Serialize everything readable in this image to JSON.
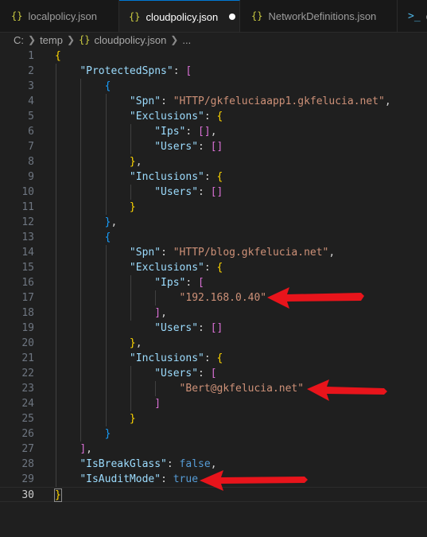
{
  "tabs": [
    {
      "label": "localpolicy.json",
      "active": false
    },
    {
      "label": "cloudpolicy.json",
      "active": true,
      "modified": true
    },
    {
      "label": "NetworkDefinitions.json",
      "active": false
    },
    {
      "label": "c",
      "active": false
    }
  ],
  "breadcrumb": [
    "C:",
    "temp",
    "cloudpolicy.json",
    "..."
  ],
  "colors": {
    "key": "#9cdcfe",
    "string": "#ce9178",
    "keyword": "#569cd6",
    "bracket_level1": "#ffd700",
    "bracket_level2": "#da70d6",
    "bracket_level3": "#179fff",
    "arrow": "#e8141b"
  },
  "annotations": [
    {
      "points_to_line": 17
    },
    {
      "points_to_line": 23
    },
    {
      "points_to_line": 29
    }
  ],
  "lines": [
    [
      [
        "b1",
        "{"
      ]
    ],
    [
      [
        "p",
        "    "
      ],
      [
        "k",
        "\"ProtectedSpns\""
      ],
      [
        "p",
        ": "
      ],
      [
        "b2",
        "["
      ]
    ],
    [
      [
        "p",
        "        "
      ],
      [
        "b3",
        "{"
      ]
    ],
    [
      [
        "p",
        "            "
      ],
      [
        "k",
        "\"Spn\""
      ],
      [
        "p",
        ": "
      ],
      [
        "s",
        "\"HTTP/gkfeluciaapp1.gkfelucia.net\""
      ],
      [
        "p",
        ","
      ]
    ],
    [
      [
        "p",
        "            "
      ],
      [
        "k",
        "\"Exclusions\""
      ],
      [
        "p",
        ": "
      ],
      [
        "b1",
        "{"
      ]
    ],
    [
      [
        "p",
        "                "
      ],
      [
        "k",
        "\"Ips\""
      ],
      [
        "p",
        ": "
      ],
      [
        "b2",
        "[]"
      ],
      [
        "p",
        ","
      ]
    ],
    [
      [
        "p",
        "                "
      ],
      [
        "k",
        "\"Users\""
      ],
      [
        "p",
        ": "
      ],
      [
        "b2",
        "[]"
      ]
    ],
    [
      [
        "p",
        "            "
      ],
      [
        "b1",
        "}"
      ],
      [
        "p",
        ","
      ]
    ],
    [
      [
        "p",
        "            "
      ],
      [
        "k",
        "\"Inclusions\""
      ],
      [
        "p",
        ": "
      ],
      [
        "b1",
        "{"
      ]
    ],
    [
      [
        "p",
        "                "
      ],
      [
        "k",
        "\"Users\""
      ],
      [
        "p",
        ": "
      ],
      [
        "b2",
        "[]"
      ]
    ],
    [
      [
        "p",
        "            "
      ],
      [
        "b1",
        "}"
      ]
    ],
    [
      [
        "p",
        "        "
      ],
      [
        "b3",
        "}"
      ],
      [
        "p",
        ","
      ]
    ],
    [
      [
        "p",
        "        "
      ],
      [
        "b3",
        "{"
      ]
    ],
    [
      [
        "p",
        "            "
      ],
      [
        "k",
        "\"Spn\""
      ],
      [
        "p",
        ": "
      ],
      [
        "s",
        "\"HTTP/blog.gkfelucia.net\""
      ],
      [
        "p",
        ","
      ]
    ],
    [
      [
        "p",
        "            "
      ],
      [
        "k",
        "\"Exclusions\""
      ],
      [
        "p",
        ": "
      ],
      [
        "b1",
        "{"
      ]
    ],
    [
      [
        "p",
        "                "
      ],
      [
        "k",
        "\"Ips\""
      ],
      [
        "p",
        ": "
      ],
      [
        "b2",
        "["
      ]
    ],
    [
      [
        "p",
        "                    "
      ],
      [
        "s",
        "\"192.168.0.40\""
      ]
    ],
    [
      [
        "p",
        "                "
      ],
      [
        "b2",
        "]"
      ],
      [
        "p",
        ","
      ]
    ],
    [
      [
        "p",
        "                "
      ],
      [
        "k",
        "\"Users\""
      ],
      [
        "p",
        ": "
      ],
      [
        "b2",
        "[]"
      ]
    ],
    [
      [
        "p",
        "            "
      ],
      [
        "b1",
        "}"
      ],
      [
        "p",
        ","
      ]
    ],
    [
      [
        "p",
        "            "
      ],
      [
        "k",
        "\"Inclusions\""
      ],
      [
        "p",
        ": "
      ],
      [
        "b1",
        "{"
      ]
    ],
    [
      [
        "p",
        "                "
      ],
      [
        "k",
        "\"Users\""
      ],
      [
        "p",
        ": "
      ],
      [
        "b2",
        "["
      ]
    ],
    [
      [
        "p",
        "                    "
      ],
      [
        "s",
        "\"Bert@gkfelucia.net\""
      ]
    ],
    [
      [
        "p",
        "                "
      ],
      [
        "b2",
        "]"
      ]
    ],
    [
      [
        "p",
        "            "
      ],
      [
        "b1",
        "}"
      ]
    ],
    [
      [
        "p",
        "        "
      ],
      [
        "b3",
        "}"
      ]
    ],
    [
      [
        "p",
        "    "
      ],
      [
        "b2",
        "]"
      ],
      [
        "p",
        ","
      ]
    ],
    [
      [
        "p",
        "    "
      ],
      [
        "k",
        "\"IsBreakGlass\""
      ],
      [
        "p",
        ": "
      ],
      [
        "kw",
        "false"
      ],
      [
        "p",
        ","
      ]
    ],
    [
      [
        "p",
        "    "
      ],
      [
        "k",
        "\"IsAuditMode\""
      ],
      [
        "p",
        ": "
      ],
      [
        "kw",
        "true"
      ]
    ],
    [
      [
        "b1",
        "}"
      ]
    ]
  ],
  "current_line": 30
}
